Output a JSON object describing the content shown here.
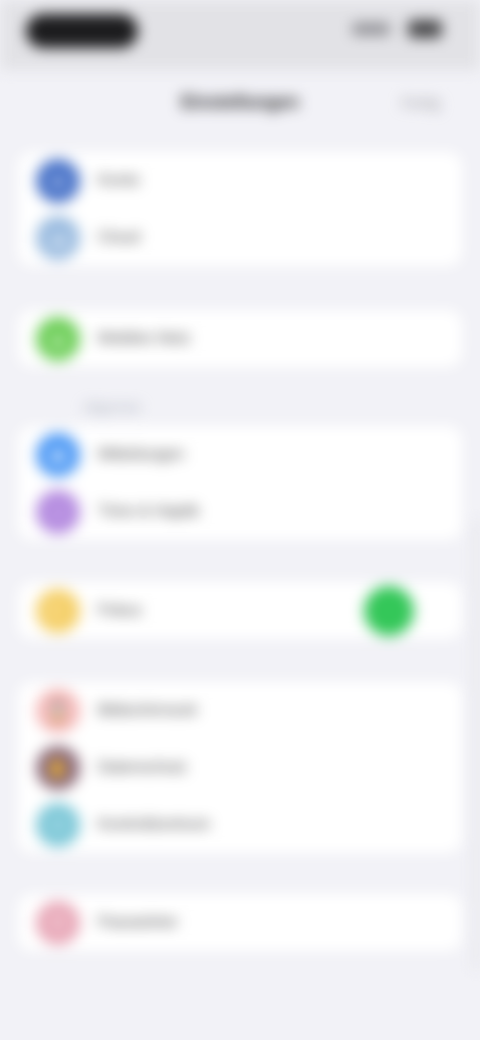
{
  "nav": {
    "title": "Einstellungen",
    "action": "Fertig"
  },
  "status_bar": {
    "time": ""
  },
  "sections": [
    {
      "caption": "",
      "items": [
        {
          "label": "Konto",
          "icon": "person-icon",
          "color": "#4a74c9",
          "glyph": "●"
        },
        {
          "label": "Cloud",
          "icon": "cloud-icon",
          "color": "#9bbce0",
          "glyph": "☁"
        }
      ]
    },
    {
      "caption": "",
      "items": [
        {
          "label": "Mobiles Netz",
          "icon": "antenna-icon",
          "color": "#6fcf5a",
          "glyph": "▲"
        }
      ]
    },
    {
      "caption": "Allgemein",
      "items": [
        {
          "label": "Mitteilungen",
          "icon": "bell-icon",
          "color": "#4f9af5",
          "glyph": "◆"
        },
        {
          "label": "Töne & Haptik",
          "icon": "speaker-icon",
          "color": "#b58ce0",
          "glyph": "♪"
        }
      ]
    },
    {
      "caption": "",
      "items": [
        {
          "label": "Fokus",
          "icon": "moon-icon",
          "color": "#f5d06a",
          "glyph": "☾",
          "toggle": true
        }
      ]
    },
    {
      "caption": "",
      "items": [
        {
          "label": "Bildschirmzeit",
          "icon": "hourglass-icon",
          "color": "#f5b8b8",
          "glyph": "⌛"
        },
        {
          "label": "Datenschutz",
          "icon": "hand-icon",
          "color": "#8c6b7a",
          "glyph": "✋"
        },
        {
          "label": "Kontrollzentrum",
          "icon": "sliders-icon",
          "color": "#7ec8d8",
          "glyph": "≡"
        }
      ]
    },
    {
      "caption": "",
      "items": [
        {
          "label": "Passwörter",
          "icon": "key-icon",
          "color": "#e8a8b8",
          "glyph": "⚿"
        }
      ]
    }
  ]
}
